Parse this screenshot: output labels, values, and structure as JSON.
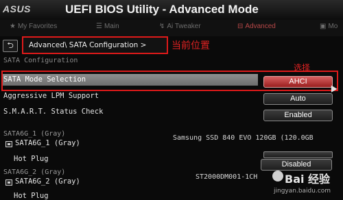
{
  "header": {
    "brand": "ASUS",
    "title": "UEFI BIOS Utility - Advanced Mode"
  },
  "tabs": [
    {
      "label": "My Favorites",
      "icon": "star-icon",
      "active": false
    },
    {
      "label": "Main",
      "icon": "list-icon",
      "active": false
    },
    {
      "label": "Ai Tweaker",
      "icon": "tweak-icon",
      "active": false
    },
    {
      "label": "Advanced",
      "icon": "advanced-icon",
      "active": true
    },
    {
      "label": "Mo",
      "icon": "monitor-icon",
      "active": false
    }
  ],
  "breadcrumb": {
    "back_icon": "back-arrow-icon",
    "text": "Advanced\\ SATA Configuration >"
  },
  "annotations": {
    "current_location": "当前位置",
    "select": "选择"
  },
  "section_title": "SATA Configuration",
  "settings": [
    {
      "label": "SATA Mode Selection",
      "value": "AHCI",
      "selected": true
    },
    {
      "label": "Aggressive LPM Support",
      "value": "Auto",
      "selected": false
    },
    {
      "label": "S.M.A.R.T. Status Check",
      "value": "Enabled",
      "selected": false
    }
  ],
  "ports": [
    {
      "group_label": "SATA6G_1 (Gray)",
      "port_label": "SATA6G_1 (Gray)",
      "device": "Samsung SSD 840 EVO 120GB (120.0GB",
      "hot_plug_label": "Hot Plug"
    },
    {
      "group_label": "SATA6G_2 (Gray)",
      "port_label": "SATA6G_2 (Gray)",
      "device": "ST2000DM001-1CH",
      "hot_plug_label": "Hot Plug",
      "hot_plug_value": "Disabled"
    }
  ],
  "watermark": {
    "logo": "Bai 经验",
    "url": "jingyan.baidu.com"
  },
  "colors": {
    "annotation_red": "#e01a1a",
    "selected_value": "#b83232",
    "active_tab": "#b94848"
  }
}
